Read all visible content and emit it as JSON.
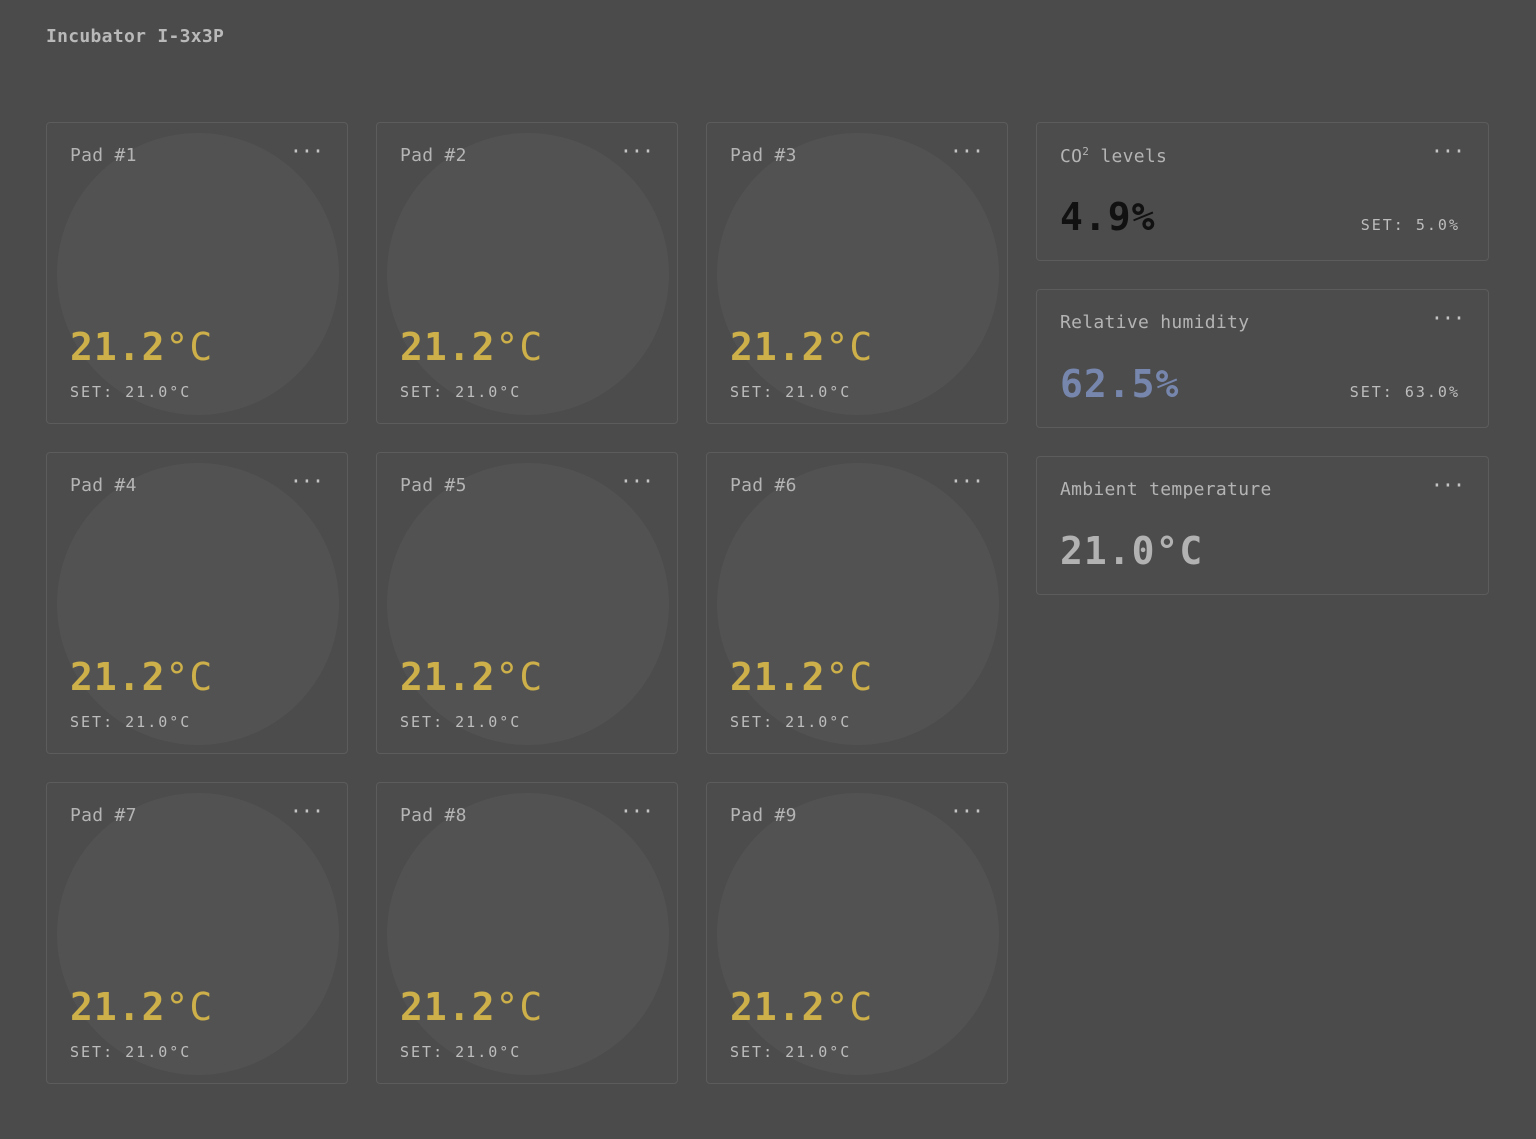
{
  "app": {
    "title": "Incubator I-3x3P"
  },
  "pads": [
    {
      "name": "Pad #1",
      "temp_value": "21.2",
      "temp_unit": "°C",
      "set": "SET: 21.0°C"
    },
    {
      "name": "Pad #2",
      "temp_value": "21.2",
      "temp_unit": "°C",
      "set": "SET: 21.0°C"
    },
    {
      "name": "Pad #3",
      "temp_value": "21.2",
      "temp_unit": "°C",
      "set": "SET: 21.0°C"
    },
    {
      "name": "Pad #4",
      "temp_value": "21.2",
      "temp_unit": "°C",
      "set": "SET: 21.0°C"
    },
    {
      "name": "Pad #5",
      "temp_value": "21.2",
      "temp_unit": "°C",
      "set": "SET: 21.0°C"
    },
    {
      "name": "Pad #6",
      "temp_value": "21.2",
      "temp_unit": "°C",
      "set": "SET: 21.0°C"
    },
    {
      "name": "Pad #7",
      "temp_value": "21.2",
      "temp_unit": "°C",
      "set": "SET: 21.0°C"
    },
    {
      "name": "Pad #8",
      "temp_value": "21.2",
      "temp_unit": "°C",
      "set": "SET: 21.0°C"
    },
    {
      "name": "Pad #9",
      "temp_value": "21.2",
      "temp_unit": "°C",
      "set": "SET: 21.0°C"
    }
  ],
  "more_label": "···",
  "co2": {
    "title_prefix": "CO",
    "title_sup": "2",
    "title_suffix": " levels",
    "value": "4.9%",
    "set": "SET: 5.0%",
    "color": "#111111"
  },
  "humidity": {
    "title": "Relative humidity",
    "value": "62.5%",
    "set": "SET: 63.0%",
    "color": "#7686ad"
  },
  "ambient": {
    "title": "Ambient temperature",
    "value": "21.0°C",
    "color": "#b2b2b2"
  },
  "colors": {
    "background": "#4b4b4b",
    "pad_temp": "#cdb049",
    "card_border": "#5c5c5c"
  },
  "icons": {
    "more": "more-horizontal-icon"
  }
}
